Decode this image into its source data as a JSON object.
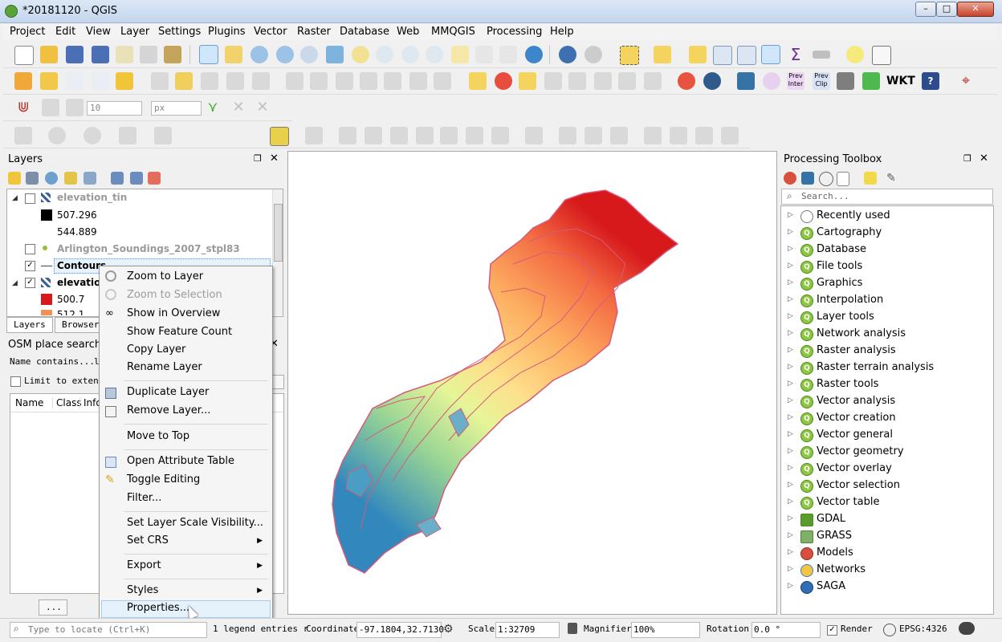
{
  "window": {
    "title": "*20181120 - QGIS",
    "min": "–",
    "max": "□",
    "close": "✕"
  },
  "menu": [
    "Project",
    "Edit",
    "View",
    "Layer",
    "Settings",
    "Plugins",
    "Vector",
    "Raster",
    "Database",
    "Web",
    "MMQGIS",
    "Processing",
    "Help"
  ],
  "toolbar": {
    "width_value": "10",
    "unit": "px"
  },
  "layers_panel": {
    "title": "Layers",
    "layers": [
      {
        "name": "elevation_tin",
        "checked": false
      },
      {
        "name": "507.296"
      },
      {
        "name": "544.889"
      },
      {
        "name": "Arlington_Soundings_2007_stpl83",
        "checked": false
      },
      {
        "name": "Contours",
        "checked": true
      },
      {
        "name": "elevation",
        "checked": true
      },
      {
        "name": "500.7"
      },
      {
        "name": "512.1"
      }
    ],
    "tabs": [
      "Layers",
      "Browser"
    ]
  },
  "osm_panel": {
    "title": "OSM place search...",
    "name_contains": "Name contains...",
    "name_value": "l",
    "limit": "Limit to extent",
    "columns": [
      "Name",
      "Class",
      "Infos"
    ],
    "more_button": "..."
  },
  "context_menu": {
    "items": [
      "Zoom to Layer",
      "Zoom to Selection",
      "Show in Overview",
      "Show Feature Count",
      "Copy Layer",
      "Rename Layer",
      "Duplicate Layer",
      "Remove Layer...",
      "Move to Top",
      "Open Attribute Table",
      "Toggle Editing",
      "Filter...",
      "Set Layer Scale Visibility...",
      "Set CRS",
      "Export",
      "Styles",
      "Properties..."
    ]
  },
  "toolbox": {
    "title": "Processing Toolbox",
    "search_placeholder": "Search...",
    "items": [
      "Recently used",
      "Cartography",
      "Database",
      "File tools",
      "Graphics",
      "Interpolation",
      "Layer tools",
      "Network analysis",
      "Raster analysis",
      "Raster terrain analysis",
      "Raster tools",
      "Vector analysis",
      "Vector creation",
      "Vector general",
      "Vector geometry",
      "Vector overlay",
      "Vector selection",
      "Vector table",
      "GDAL",
      "GRASS",
      "Models",
      "Networks",
      "SAGA"
    ]
  },
  "statusbar": {
    "locate_placeholder": "Type to locate (Ctrl+K)",
    "legend_msg": "1 legend entries r",
    "coordinate_label": "Coordinate",
    "coordinate_value": "-97.1804,32.7130",
    "scale_label": "Scale",
    "scale_value": "1:32709",
    "magnifier_label": "Magnifier",
    "magnifier_value": "100%",
    "rotation_label": "Rotation",
    "rotation_value": "0.0 °",
    "render_label": "Render",
    "epsg": "EPSG:4326"
  },
  "colors": {
    "accent": "#3399ff",
    "selection": "#cce8ff"
  }
}
